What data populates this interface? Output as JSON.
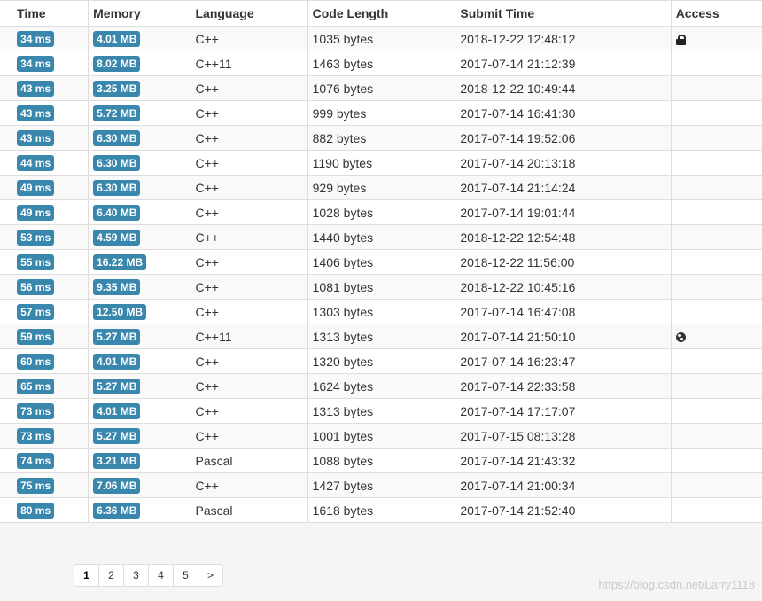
{
  "columns": {
    "time": "Time",
    "memory": "Memory",
    "language": "Language",
    "code_length": "Code Length",
    "submit_time": "Submit Time",
    "access": "Access"
  },
  "rows": [
    {
      "time": "34 ms",
      "memory": "4.01 MB",
      "language": "C++",
      "code_length": "1035 bytes",
      "submit_time": "2018-12-22 12:48:12",
      "access": "lock-icon"
    },
    {
      "time": "34 ms",
      "memory": "8.02 MB",
      "language": "C++11",
      "code_length": "1463 bytes",
      "submit_time": "2017-07-14 21:12:39",
      "access": ""
    },
    {
      "time": "43 ms",
      "memory": "3.25 MB",
      "language": "C++",
      "code_length": "1076 bytes",
      "submit_time": "2018-12-22 10:49:44",
      "access": ""
    },
    {
      "time": "43 ms",
      "memory": "5.72 MB",
      "language": "C++",
      "code_length": "999 bytes",
      "submit_time": "2017-07-14 16:41:30",
      "access": ""
    },
    {
      "time": "43 ms",
      "memory": "6.30 MB",
      "language": "C++",
      "code_length": "882 bytes",
      "submit_time": "2017-07-14 19:52:06",
      "access": ""
    },
    {
      "time": "44 ms",
      "memory": "6.30 MB",
      "language": "C++",
      "code_length": "1190 bytes",
      "submit_time": "2017-07-14 20:13:18",
      "access": ""
    },
    {
      "time": "49 ms",
      "memory": "6.30 MB",
      "language": "C++",
      "code_length": "929 bytes",
      "submit_time": "2017-07-14 21:14:24",
      "access": ""
    },
    {
      "time": "49 ms",
      "memory": "6.40 MB",
      "language": "C++",
      "code_length": "1028 bytes",
      "submit_time": "2017-07-14 19:01:44",
      "access": ""
    },
    {
      "time": "53 ms",
      "memory": "4.59 MB",
      "language": "C++",
      "code_length": "1440 bytes",
      "submit_time": "2018-12-22 12:54:48",
      "access": ""
    },
    {
      "time": "55 ms",
      "memory": "16.22 MB",
      "language": "C++",
      "code_length": "1406 bytes",
      "submit_time": "2018-12-22 11:56:00",
      "access": ""
    },
    {
      "time": "56 ms",
      "memory": "9.35 MB",
      "language": "C++",
      "code_length": "1081 bytes",
      "submit_time": "2018-12-22 10:45:16",
      "access": ""
    },
    {
      "time": "57 ms",
      "memory": "12.50 MB",
      "language": "C++",
      "code_length": "1303 bytes",
      "submit_time": "2017-07-14 16:47:08",
      "access": ""
    },
    {
      "time": "59 ms",
      "memory": "5.27 MB",
      "language": "C++11",
      "code_length": "1313 bytes",
      "submit_time": "2017-07-14 21:50:10",
      "access": "globe-icon"
    },
    {
      "time": "60 ms",
      "memory": "4.01 MB",
      "language": "C++",
      "code_length": "1320 bytes",
      "submit_time": "2017-07-14 16:23:47",
      "access": ""
    },
    {
      "time": "65 ms",
      "memory": "5.27 MB",
      "language": "C++",
      "code_length": "1624 bytes",
      "submit_time": "2017-07-14 22:33:58",
      "access": ""
    },
    {
      "time": "73 ms",
      "memory": "4.01 MB",
      "language": "C++",
      "code_length": "1313 bytes",
      "submit_time": "2017-07-14 17:17:07",
      "access": ""
    },
    {
      "time": "73 ms",
      "memory": "5.27 MB",
      "language": "C++",
      "code_length": "1001 bytes",
      "submit_time": "2017-07-15 08:13:28",
      "access": ""
    },
    {
      "time": "74 ms",
      "memory": "3.21 MB",
      "language": "Pascal",
      "code_length": "1088 bytes",
      "submit_time": "2017-07-14 21:43:32",
      "access": ""
    },
    {
      "time": "75 ms",
      "memory": "7.06 MB",
      "language": "C++",
      "code_length": "1427 bytes",
      "submit_time": "2017-07-14 21:00:34",
      "access": ""
    },
    {
      "time": "80 ms",
      "memory": "6.36 MB",
      "language": "Pascal",
      "code_length": "1618 bytes",
      "submit_time": "2017-07-14 21:52:40",
      "access": ""
    }
  ],
  "pagination": {
    "pages": [
      "1",
      "2",
      "3",
      "4",
      "5"
    ],
    "next": ">",
    "current": "1"
  },
  "watermark": "https://blog.csdn.net/Larry1118",
  "colors": {
    "label_bg": "#3a87ad",
    "link_text": "#333333"
  }
}
